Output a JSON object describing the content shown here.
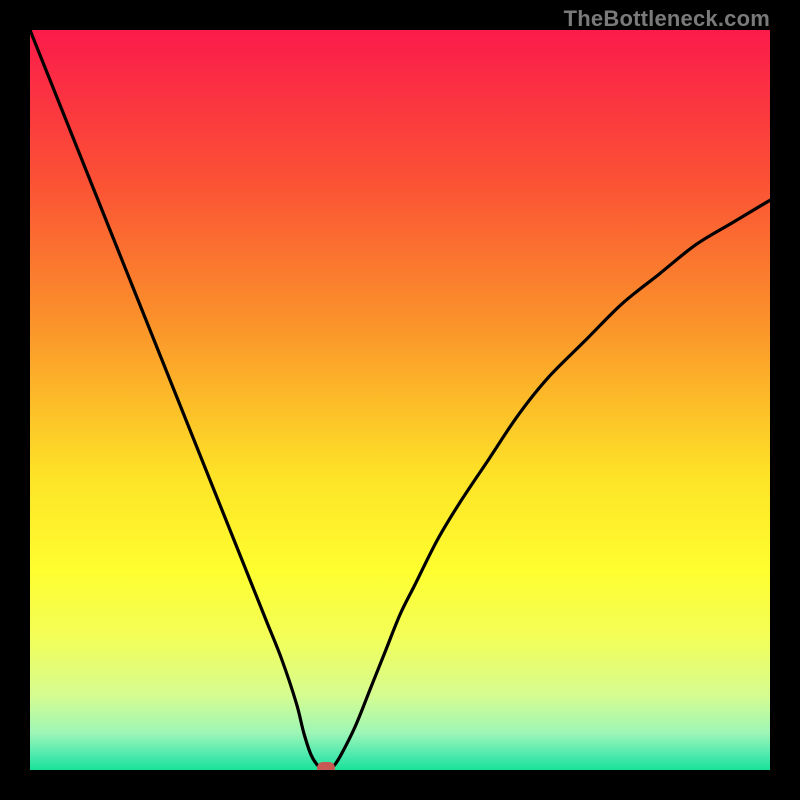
{
  "watermark": {
    "text": "TheBottleneck.com"
  },
  "chart_data": {
    "type": "line",
    "title": "",
    "xlabel": "",
    "ylabel": "",
    "xlim": [
      0,
      100
    ],
    "ylim": [
      0,
      100
    ],
    "x": [
      0,
      2,
      4,
      6,
      8,
      10,
      12,
      14,
      16,
      18,
      20,
      22,
      24,
      26,
      28,
      30,
      32,
      34,
      36,
      37,
      38,
      39,
      40,
      41,
      42,
      44,
      46,
      48,
      50,
      52,
      55,
      58,
      62,
      66,
      70,
      75,
      80,
      85,
      90,
      95,
      100
    ],
    "values": [
      100,
      95,
      90,
      85,
      80,
      75,
      70,
      65,
      60,
      55,
      50,
      45,
      40,
      35,
      30,
      25,
      20,
      15,
      9,
      5,
      2,
      0.5,
      0,
      0.5,
      2,
      6,
      11,
      16,
      21,
      25,
      31,
      36,
      42,
      48,
      53,
      58,
      63,
      67,
      71,
      74,
      77
    ],
    "marker": {
      "x": 40,
      "y": 0,
      "color": "#c85a54"
    },
    "gradient_stops": [
      {
        "offset": 0.0,
        "color": "#fb1b4b"
      },
      {
        "offset": 0.2,
        "color": "#fb5035"
      },
      {
        "offset": 0.4,
        "color": "#fb942a"
      },
      {
        "offset": 0.6,
        "color": "#fde227"
      },
      {
        "offset": 0.73,
        "color": "#fefe2f"
      },
      {
        "offset": 0.82,
        "color": "#f3fe58"
      },
      {
        "offset": 0.9,
        "color": "#d5fc91"
      },
      {
        "offset": 0.95,
        "color": "#9df6b7"
      },
      {
        "offset": 0.98,
        "color": "#4de9ae"
      },
      {
        "offset": 1.0,
        "color": "#18e298"
      }
    ]
  }
}
